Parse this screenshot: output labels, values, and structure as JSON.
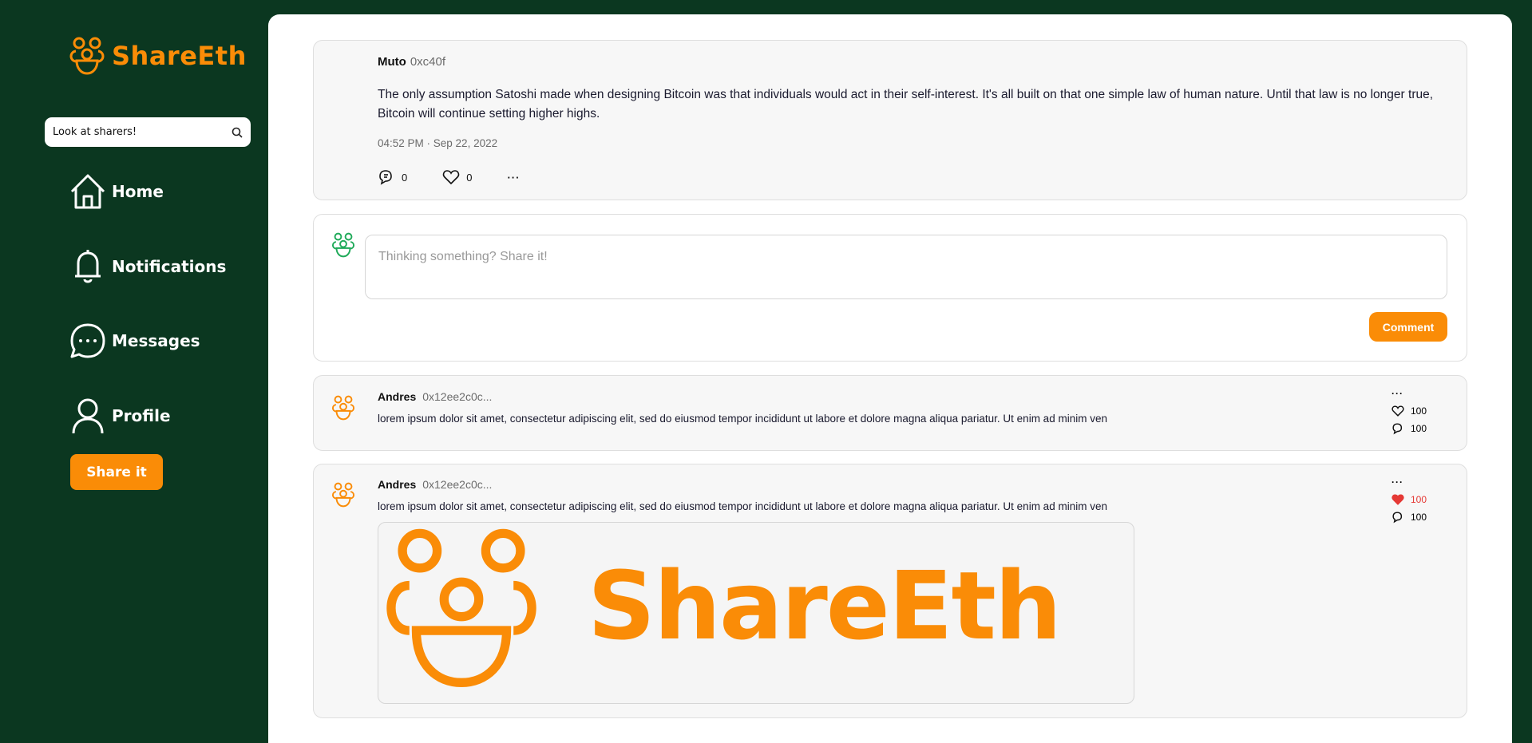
{
  "app": {
    "name": "ShareEth",
    "brand_color": "#fa8c07",
    "bg_color": "#0b3720"
  },
  "search": {
    "placeholder": "Look at sharers!"
  },
  "nav": [
    {
      "label": "Home",
      "icon": "home-icon"
    },
    {
      "label": "Notifications",
      "icon": "bell-icon"
    },
    {
      "label": "Messages",
      "icon": "message-icon"
    },
    {
      "label": "Profile",
      "icon": "user-icon"
    }
  ],
  "share_button": "Share it",
  "main_post": {
    "author": "Muto",
    "handle": "0xc40f",
    "text": "The only assumption Satoshi made when designing Bitcoin   was that individuals would act in their self-interest. It's all built on that one simple law of human nature. Until that law is no longer true, Bitcoin will continue setting higher highs.",
    "timestamp": "04:52 PM · Sep 22, 2022",
    "comments": "0",
    "likes": "0",
    "more": "···"
  },
  "composer": {
    "placeholder": "Thinking something? Share it!",
    "button": "Comment"
  },
  "comments": [
    {
      "author": "Andres",
      "handle": "0x12ee2c0c...",
      "text": "lorem ipsum dolor sit amet, consectetur adipiscing elit, sed do eiusmod tempor incididunt ut labore et dolore magna aliqua pariatur. Ut enim ad minim ven",
      "likes": "100",
      "comments": "100",
      "liked": false,
      "more": "···"
    },
    {
      "author": "Andres",
      "handle": "0x12ee2c0c...",
      "text": "lorem ipsum dolor sit amet, consectetur adipiscing elit, sed do eiusmod tempor incididunt ut labore et dolore magna aliqua pariatur. Ut enim ad minim ven",
      "likes": "100",
      "comments": "100",
      "liked": true,
      "like_color": "#e53935",
      "more": "···"
    }
  ]
}
